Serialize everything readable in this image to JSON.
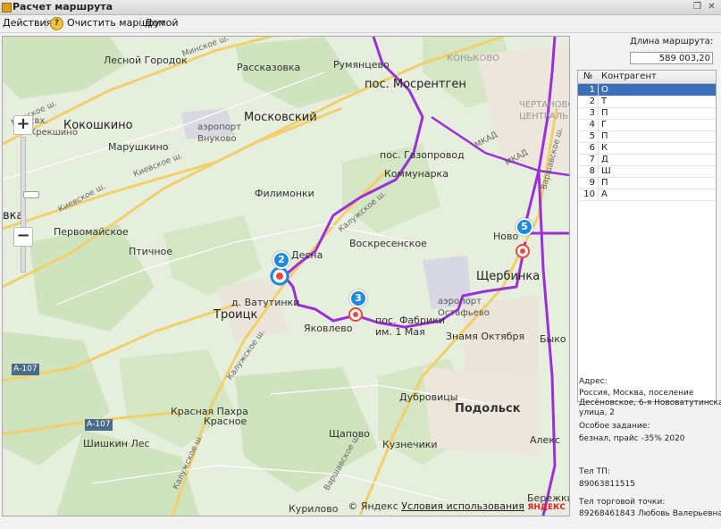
{
  "window": {
    "title": "Расчет маршрута"
  },
  "toolbar": {
    "actions": "Действия ▾",
    "clear": "Очистить маршрут",
    "home": "Домой"
  },
  "map": {
    "labels": {
      "lesnoy": "Лесной Городок",
      "rasskazovka": "Рассказовка",
      "rumyantsevo": "Румянцево",
      "mosrentgen": "пос. Мосрентген",
      "kokoshkino": "Кокошкино",
      "moskovsky": "Московский",
      "svkr": "свх.\nКрекшино",
      "vnukovo": "аэропорт\nВнуково",
      "marushkino": "Марушкино",
      "gazoprovod": "пос. Газопровод",
      "kommunarka": "Коммунарка",
      "filimonki": "Филимонки",
      "vka": "вка",
      "pervomayskoe": "Первомайское",
      "ptichnoe": "Птичное",
      "desna": "Десна",
      "voskresenskoe": "Воскресенское",
      "novoe": "Ново",
      "shcherbinka": "Щербинка",
      "vatutinki": "д. Ватутинки",
      "troitsk": "Троицк",
      "yakovlevo": "Яковлево",
      "fabriki": "пос. Фабрики\nим. 1 Мая",
      "ostafievo": "аэропорт\nОстафьево",
      "znamya": "Знамя Октября",
      "byk": "Быко",
      "dubrovitsy": "Дубровицы",
      "podolsk": "Подольск",
      "krasnaya": "Красная Пахра",
      "krasnoe": "Красное",
      "shishkin": "Шишкин Лес",
      "shchapovo": "Щапово",
      "kuznechiki": "Кузнечики",
      "alek": "Алекс",
      "kurilovo": "Курилово",
      "berezhki": "Бережки",
      "chertanovo": "ЧЕРТАНОВО\nЦЕНТРАЛЬНОЕ",
      "konkovo": "КОНЬКОВО",
      "r_minsk": "Минское ш.",
      "r_minsk2": "Минское ш.",
      "r_kiev": "Киевское ш.",
      "r_kiev2": "Киевское ш.",
      "r_kaluzh": "Калужское ш.",
      "r_kaluzh2": "Калужское ш.",
      "r_kaluzh3": "Калужское ш.",
      "r_warsh": "Варшавское ш.",
      "r_warsh2": "Варшавское ш.",
      "r_mkad": "МКАД",
      "r_mkad2": "МКАД",
      "a107": "А-107",
      "a107b": "А-107",
      "yandex_logo": "ЯНДЕКС"
    },
    "markers": [
      "2",
      "3",
      "5"
    ],
    "copyright": {
      "prefix": "© Яндекс",
      "link": "Условия использования"
    }
  },
  "route": {
    "length_label": "Длина маршрута:",
    "length_value": "589 003,20",
    "table": {
      "col_num": "№",
      "col_name": "Контрагент",
      "rows": [
        {
          "n": "1",
          "c": "О"
        },
        {
          "n": "2",
          "c": "Т"
        },
        {
          "n": "3",
          "c": "П"
        },
        {
          "n": "4",
          "c": "Г"
        },
        {
          "n": "5",
          "c": "П"
        },
        {
          "n": "6",
          "c": "К"
        },
        {
          "n": "7",
          "c": "Д"
        },
        {
          "n": "8",
          "c": "Ш"
        },
        {
          "n": "9",
          "c": "П"
        },
        {
          "n": "10",
          "c": "А"
        }
      ]
    }
  },
  "details": {
    "address_label": "Адрес:",
    "address_1": "Россия, Москва, поселение",
    "address_2": "Десёновское, 6-я Нововатутинская",
    "address_3": "улица, 2",
    "task_label": "Особое задание:",
    "task_value": "безнал, прайс -35% 2020",
    "tel_tp_label": "Тел ТП:",
    "tel_tp_value": "89063811515",
    "tel_point_label": "Тел торговой точки:",
    "tel_point_value": "89268461843 Любовь Валерьевна"
  },
  "colors": {
    "route": "#9b30d8",
    "marker": "#1a8ae5",
    "selection": "#3d6fb8",
    "road": "#f2cf6a"
  }
}
